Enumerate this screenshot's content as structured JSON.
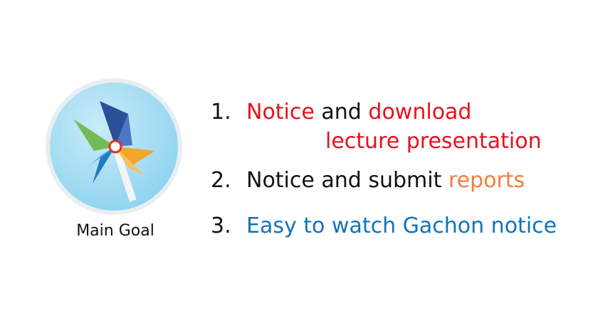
{
  "logo": {
    "icon": "pinwheel-icon",
    "caption": "Main Goal"
  },
  "goals": [
    {
      "number": "1.",
      "parts": [
        "Notice",
        "and",
        "download"
      ],
      "continuation": "lecture presentation"
    },
    {
      "number": "2.",
      "parts": [
        "Notice and submit",
        "reports"
      ]
    },
    {
      "number": "3.",
      "parts": [
        "Easy to watch Gachon notice"
      ]
    }
  ],
  "colors": {
    "red": "#e8111d",
    "black": "#111111",
    "orange": "#ef7f3f",
    "blue": "#1174b8"
  }
}
